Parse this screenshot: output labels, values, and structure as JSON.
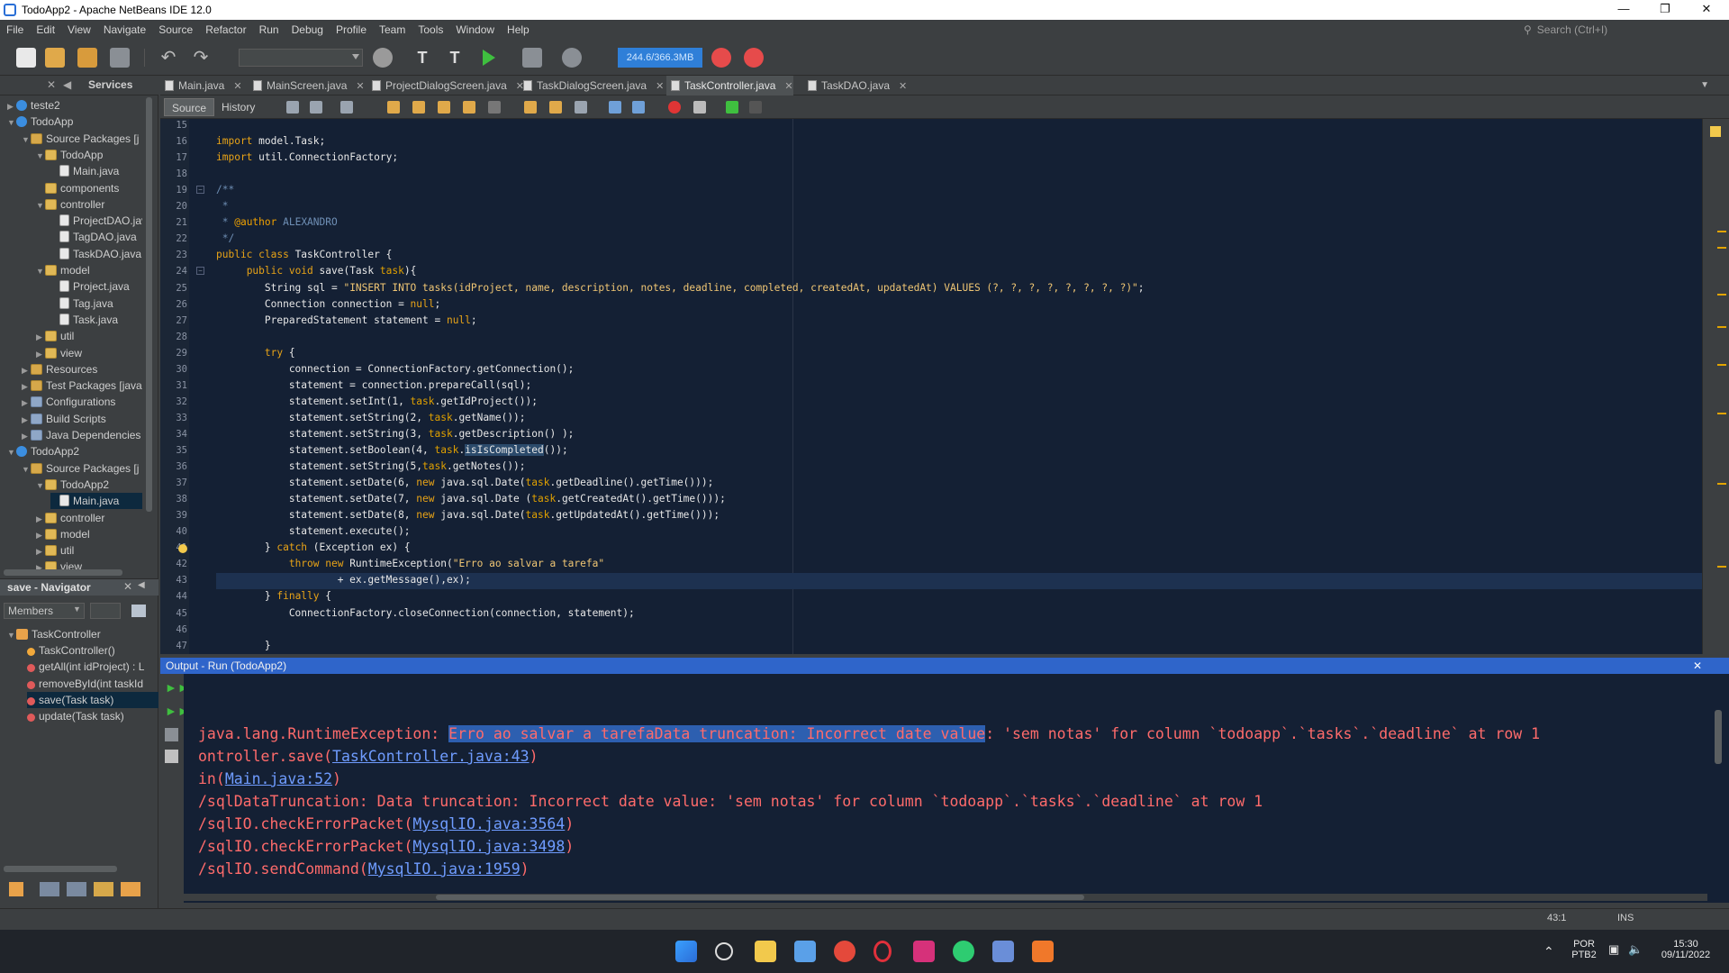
{
  "window": {
    "title": "TodoApp2 - Apache NetBeans IDE 12.0"
  },
  "menu": [
    "File",
    "Edit",
    "View",
    "Navigate",
    "Source",
    "Refactor",
    "Run",
    "Debug",
    "Profile",
    "Team",
    "Tools",
    "Window",
    "Help"
  ],
  "search": {
    "placeholder": "Search (Ctrl+I)"
  },
  "toolbar": {
    "memory": "244.6/366.3MB"
  },
  "projects_panel": {
    "tab_services": "Services",
    "tree": [
      {
        "label": "teste2",
        "indent": 0,
        "type": "proj",
        "tw": "▶"
      },
      {
        "label": "TodoApp",
        "indent": 0,
        "type": "proj",
        "tw": "▼"
      },
      {
        "label": "Source Packages [j",
        "indent": 1,
        "type": "pkg",
        "tw": "▼"
      },
      {
        "label": "TodoApp",
        "indent": 2,
        "type": "folder",
        "tw": "▼"
      },
      {
        "label": "Main.java",
        "indent": 3,
        "type": "file",
        "tw": ""
      },
      {
        "label": "components",
        "indent": 2,
        "type": "folder",
        "tw": ""
      },
      {
        "label": "controller",
        "indent": 2,
        "type": "folder",
        "tw": "▼"
      },
      {
        "label": "ProjectDAO.java",
        "indent": 3,
        "type": "file",
        "tw": ""
      },
      {
        "label": "TagDAO.java",
        "indent": 3,
        "type": "file",
        "tw": ""
      },
      {
        "label": "TaskDAO.java",
        "indent": 3,
        "type": "file",
        "tw": ""
      },
      {
        "label": "model",
        "indent": 2,
        "type": "folder",
        "tw": "▼"
      },
      {
        "label": "Project.java",
        "indent": 3,
        "type": "file",
        "tw": ""
      },
      {
        "label": "Tag.java",
        "indent": 3,
        "type": "file",
        "tw": ""
      },
      {
        "label": "Task.java",
        "indent": 3,
        "type": "file",
        "tw": ""
      },
      {
        "label": "util",
        "indent": 2,
        "type": "folder",
        "tw": "▶"
      },
      {
        "label": "view",
        "indent": 2,
        "type": "folder",
        "tw": "▶"
      },
      {
        "label": "Resources",
        "indent": 1,
        "type": "pkg",
        "tw": "▶"
      },
      {
        "label": "Test Packages [java",
        "indent": 1,
        "type": "pkg",
        "tw": "▶"
      },
      {
        "label": "Configurations",
        "indent": 1,
        "type": "lib",
        "tw": "▶"
      },
      {
        "label": "Build Scripts",
        "indent": 1,
        "type": "lib",
        "tw": "▶"
      },
      {
        "label": "Java Dependencies",
        "indent": 1,
        "type": "lib",
        "tw": "▶"
      },
      {
        "label": "TodoApp2",
        "indent": 0,
        "type": "proj",
        "tw": "▼"
      },
      {
        "label": "Source Packages [j",
        "indent": 1,
        "type": "pkg",
        "tw": "▼"
      },
      {
        "label": "TodoApp2",
        "indent": 2,
        "type": "folder",
        "tw": "▼"
      },
      {
        "label": "Main.java",
        "indent": 3,
        "type": "file",
        "tw": "",
        "selected": true
      },
      {
        "label": "controller",
        "indent": 2,
        "type": "folder",
        "tw": "▶"
      },
      {
        "label": "model",
        "indent": 2,
        "type": "folder",
        "tw": "▶"
      },
      {
        "label": "util",
        "indent": 2,
        "type": "folder",
        "tw": "▶"
      },
      {
        "label": "view",
        "indent": 2,
        "type": "folder",
        "tw": "▶"
      }
    ]
  },
  "navigator": {
    "title": "save - Navigator",
    "filter": "Members",
    "root": "TaskController",
    "items": [
      {
        "label": "TaskController()",
        "color": "#f2a93b",
        "selected": false
      },
      {
        "label": "getAll(int idProject) : L",
        "color": "#e05a5a",
        "selected": false
      },
      {
        "label": "removeById(int taskId",
        "color": "#e05a5a",
        "selected": false
      },
      {
        "label": "save(Task task)",
        "color": "#e05a5a",
        "selected": true
      },
      {
        "label": "update(Task task)",
        "color": "#e05a5a",
        "selected": false
      }
    ]
  },
  "editor_tabs": [
    {
      "label": "Main.java",
      "active": false
    },
    {
      "label": "MainScreen.java",
      "active": false
    },
    {
      "label": "ProjectDialogScreen.java",
      "active": false
    },
    {
      "label": "TaskDialogScreen.java",
      "active": false
    },
    {
      "label": "TaskController.java",
      "active": true
    },
    {
      "label": "TaskDAO.java",
      "active": false
    }
  ],
  "editor_toolbar": {
    "source": "Source",
    "history": "History"
  },
  "code_lines": [
    {
      "n": "15",
      "html": ""
    },
    {
      "n": "16",
      "html": "<span class='kw'>import</span> model.Task;"
    },
    {
      "n": "17",
      "html": "<span class='kw'>import</span> util.ConnectionFactory;"
    },
    {
      "n": "18",
      "html": ""
    },
    {
      "n": "19",
      "html": "<span class='cm'>/**</span>"
    },
    {
      "n": "20",
      "html": "<span class='cm'> *</span>"
    },
    {
      "n": "21",
      "html": "<span class='cm'> * </span><span class='an'>@author</span><span class='cm'> ALEXANDRO</span>"
    },
    {
      "n": "22",
      "html": "<span class='cm'> */</span>"
    },
    {
      "n": "23",
      "html": "<span class='kw'>public class</span> TaskController {"
    },
    {
      "n": "24",
      "html": "     <span class='kw'>public void</span> save(Task <span class='prm'>task</span>){"
    },
    {
      "n": "25",
      "html": "        String sql = <span class='str'>\"INSERT INTO tasks(idProject, name, description, notes, deadline, completed, createdAt, updatedAt) VALUES (?, ?, ?, ?, ?, ?, ?, ?)\"</span>;"
    },
    {
      "n": "26",
      "html": "        Connection connection = <span class='kw'>null</span>;"
    },
    {
      "n": "27",
      "html": "        PreparedStatement statement = <span class='kw'>null</span>;"
    },
    {
      "n": "28",
      "html": ""
    },
    {
      "n": "29",
      "html": "        <span class='kw'>try</span> {"
    },
    {
      "n": "30",
      "html": "            connection = ConnectionFactory.getConnection();"
    },
    {
      "n": "31",
      "html": "            statement = connection.prepareCall(sql);"
    },
    {
      "n": "32",
      "html": "            statement.setInt(1, <span class='prm'>task</span>.getIdProject());"
    },
    {
      "n": "33",
      "html": "            statement.setString(2, <span class='prm'>task</span>.getName());"
    },
    {
      "n": "34",
      "html": "            statement.setString(3, <span class='prm'>task</span>.getDescription() );"
    },
    {
      "n": "35",
      "html": "            statement.setBoolean(4, <span class='prm'>task</span>.<span class='hl'>isIsCompleted</span>());"
    },
    {
      "n": "36",
      "html": "            statement.setString(5,<span class='prm'>task</span>.getNotes());"
    },
    {
      "n": "37",
      "html": "            statement.setDate(6, <span class='kw'>new</span> java.sql.Date(<span class='prm'>task</span>.getDeadline().getTime()));"
    },
    {
      "n": "38",
      "html": "            statement.setDate(7, <span class='kw'>new</span> java.sql.Date (<span class='prm'>task</span>.getCreatedAt().getTime()));"
    },
    {
      "n": "39",
      "html": "            statement.setDate(8, <span class='kw'>new</span> java.sql.Date(<span class='prm'>task</span>.getUpdatedAt().getTime()));"
    },
    {
      "n": "40",
      "html": "            statement.execute();"
    },
    {
      "n": "41",
      "html": "        } <span class='kw'>catch</span> (Exception ex) {"
    },
    {
      "n": "42",
      "html": "            <span class='kw'>throw new</span> RuntimeException(<span class='str'>\"Erro ao salvar a tarefa\"</span>"
    },
    {
      "n": "43",
      "html": "                    + ex.getMessage(),ex);"
    },
    {
      "n": "44",
      "html": "        } <span class='kw'>finally</span> {"
    },
    {
      "n": "45",
      "html": "            ConnectionFactory.closeConnection(connection, statement);"
    },
    {
      "n": "46",
      "html": ""
    },
    {
      "n": "47",
      "html": "        }"
    }
  ],
  "output": {
    "title": "Output - Run (TodoApp2)",
    "lines": [
      "",
      "",
      "java.lang.RuntimeException: |SEL|Erro ao salvar a tarefaData truncation: Incorrect date value|/SEL|: 'sem notas' for column `todoapp`.`tasks`.`deadline` at row 1",
      "ontroller.save(|LINK|TaskController.java:43|/LINK|)",
      "in(|LINK|Main.java:52|/LINK|)",
      "/sqlDataTruncation: Data truncation: Incorrect date value: 'sem notas' for column `todoapp`.`tasks`.`deadline` at row 1",
      "/sqlIO.checkErrorPacket(|LINK|MysqlIO.java:3564|/LINK|)",
      "/sqlIO.checkErrorPacket(|LINK|MysqlIO.java:3498|/LINK|)",
      "/sqlIO.sendCommand(|LINK|MysqlIO.java:1959|/LINK|)"
    ]
  },
  "status": {
    "position": "43:1",
    "mode": "INS"
  },
  "taskbar": {
    "lang": "POR",
    "layout": "PTB2",
    "time": "15:30",
    "date": "09/11/2022"
  }
}
